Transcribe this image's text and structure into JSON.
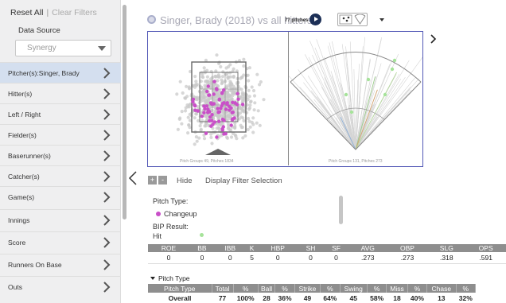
{
  "sidebar": {
    "reset_all": "Reset All",
    "separator": "|",
    "clear_filters": "Clear Filters",
    "data_source_label": "Data Source",
    "data_source_value": "Synergy",
    "items": [
      {
        "label": "Pitcher(s):Singer, Brady",
        "active": true
      },
      {
        "label": "Hitter(s)"
      },
      {
        "label": "Left / Right"
      },
      {
        "label": "Fielder(s)"
      },
      {
        "label": "Baserunner(s)"
      },
      {
        "label": "Catcher(s)"
      },
      {
        "label": "Game(s)"
      },
      {
        "label": "Innings"
      },
      {
        "label": "Score"
      },
      {
        "label": "Runners On Base"
      },
      {
        "label": "Outs"
      }
    ]
  },
  "header": {
    "title": "Singer, Brady (2018) vs all hitters",
    "pitch_count": "77 pitches"
  },
  "plots": {
    "left_footer": "Pitch Groups 49, Pitches 1834",
    "right_footer": "Pitch Groups 131, Pitches 273"
  },
  "controls": {
    "plus": "+",
    "minus": "-",
    "hide": "Hide",
    "display_filter": "Display Filter Selection"
  },
  "filters": {
    "pitch_type_label": "Pitch Type:",
    "pitch_type_value": "Changeup",
    "bip_label": "BIP Result:",
    "bip_value": "Hit"
  },
  "stats_table": {
    "headers": [
      "ROE",
      "BB",
      "IBB",
      "K",
      "HBP",
      "SH",
      "SF",
      "AVG",
      "OBP",
      "SLG",
      "OPS"
    ],
    "row": [
      "0",
      "0",
      "0",
      "5",
      "0",
      "0",
      "0",
      ".273",
      ".273",
      ".318",
      ".591"
    ]
  },
  "pitch_section": {
    "title": "Pitch Type",
    "headers": [
      "Pitch Type",
      "Total",
      "%",
      "Ball",
      "%",
      "Strike",
      "%",
      "Swing",
      "%",
      "Miss",
      "%",
      "Chase",
      "%"
    ],
    "row": [
      "Overall",
      "77",
      "100%",
      "28",
      "36%",
      "49",
      "64%",
      "45",
      "58%",
      "18",
      "40%",
      "13",
      "32%"
    ]
  },
  "colors": {
    "accent_border": "#5258b6",
    "changeup": "#c94fc8",
    "hit": "#a6e39a",
    "active_item": "#d4dfef"
  }
}
